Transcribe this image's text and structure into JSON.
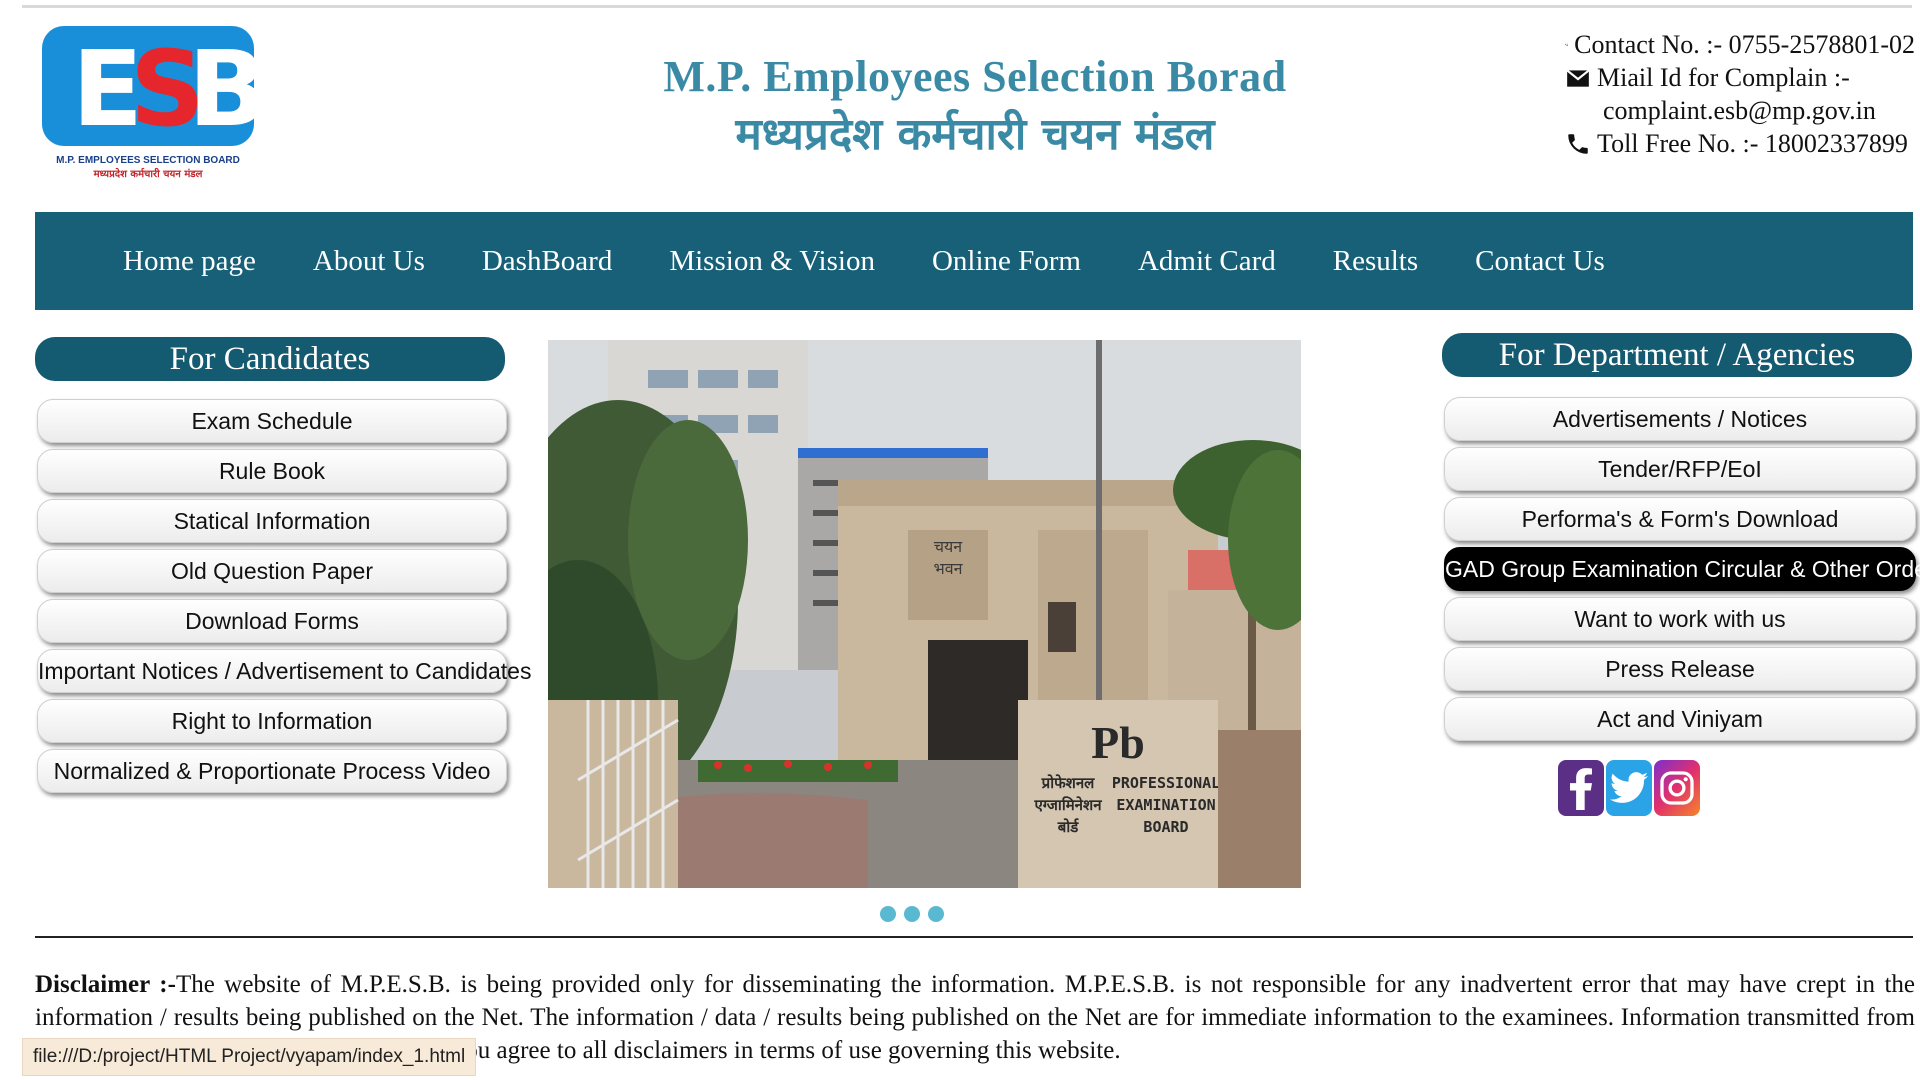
{
  "header": {
    "logo_text": "ESB",
    "logo_caption_en": "M.P. EMPLOYEES SELECTION BOARD",
    "logo_caption_hi": "मध्यप्रदेश कर्मचारी चयन मंडल",
    "title_en": "M.P. Employees Selection Borad",
    "title_hi": "मध्यप्रदेश कर्मचारी चयन मंडल",
    "contact_no": "Contact No. :- 0755-2578801-02",
    "mail_label": "Miail Id for Complain :-",
    "mail_value": "complaint.esb@mp.gov.in",
    "toll_free": "Toll Free No. :- 18002337899"
  },
  "nav": {
    "items": [
      "Home page",
      "About Us",
      "DashBoard",
      "Mission & Vision",
      "Online Form",
      "Admit Card",
      "Results",
      "Contact Us"
    ]
  },
  "candidates": {
    "heading": "For Candidates",
    "items": [
      "Exam Schedule",
      "Rule Book",
      "Statical Information",
      "Old Question Paper",
      "Download Forms",
      "Important Notices / Advertisement to Candidates",
      "Right to Information",
      "Normalized & Proportionate Process Video"
    ]
  },
  "departments": {
    "heading": "For Department / Agencies",
    "items": [
      "Advertisements / Notices",
      "Tender/RFP/EoI",
      "Performa's & Form's Download",
      "GAD Group Examination Circular & Other Order",
      "Want to work with us",
      "Press Release",
      "Act and Viniyam"
    ],
    "active_index": 3
  },
  "hero": {
    "sign_hi_1": "प्रोफेशनल",
    "sign_hi_2": "एग्जामिनेशन",
    "sign_hi_3": "बोर्ड",
    "sign_en_1": "PROFESSIONAL",
    "sign_en_2": "EXAMINATION",
    "sign_en_3": "BOARD",
    "building_hi_1": "चयन",
    "building_hi_2": "भवन",
    "slide_count": 3
  },
  "social": [
    "facebook-icon",
    "twitter-icon",
    "instagram-icon"
  ],
  "disclaimer": {
    "label": "Disclaimer :-",
    "text": "The website of M.P.E.S.B. is being provided only for disseminating the information. M.P.E.S.B. is not responsible for any inadvertent error that may have crept in the information / results being published on the Net. The information / data / results being published on the Net are for immediate information to the examinees. Information transmitted from this website cannot",
    "text_tail": "using our website, you agree to all disclaimers in terms of use governing this website."
  },
  "status_url": "file:///D:/project/HTML Project/vyapam/index_1.html",
  "colors": {
    "nav": "#176077",
    "title": "#3a8aa6",
    "logo_red": "#e5262c",
    "logo_blue": "#1a8fd9"
  }
}
